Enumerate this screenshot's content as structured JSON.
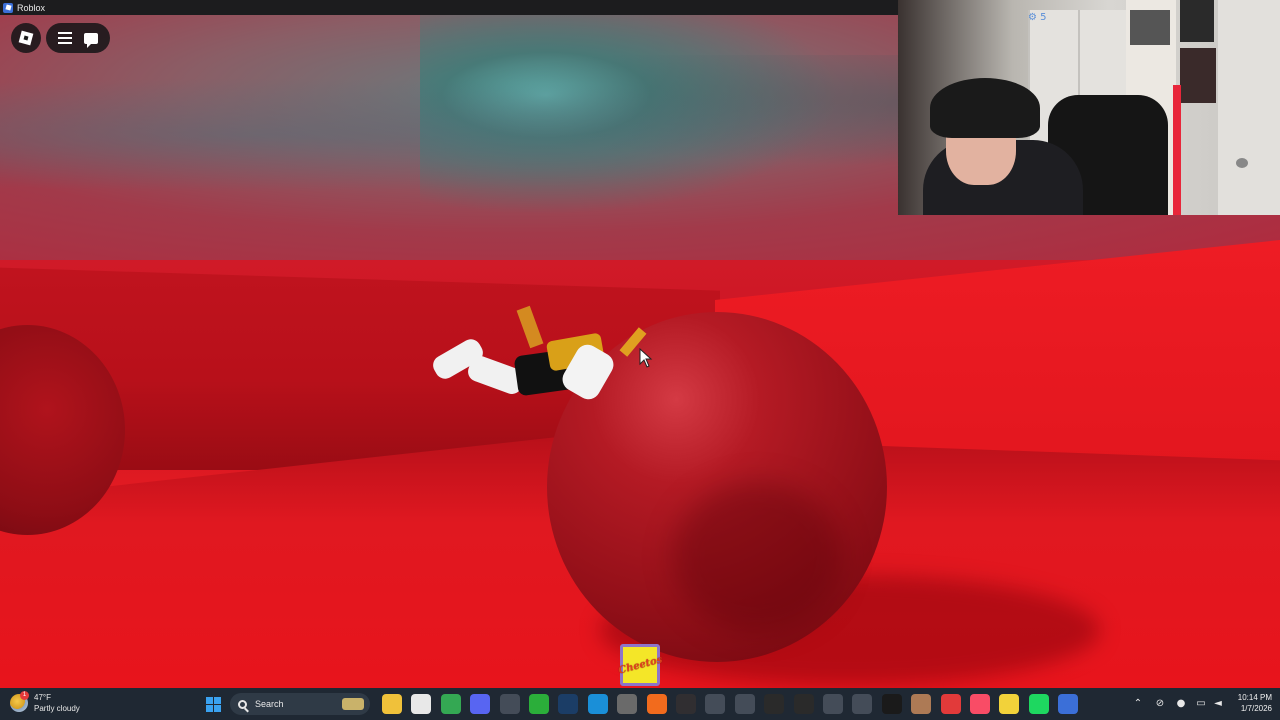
{
  "window": {
    "title": "Roblox"
  },
  "game": {
    "hotbar_item_label": "Cheetos"
  },
  "webcam": {
    "overlay_text": "⚙ 5"
  },
  "taskbar": {
    "weather": {
      "temperature": "47°F",
      "condition": "Partly cloudy",
      "badge": "1"
    },
    "search_placeholder": "Search",
    "clock": {
      "time": "10:14 PM",
      "date": "1/7/2026"
    },
    "pinned_apps": [
      {
        "name": "start-menu",
        "color": "#3aa2f0"
      },
      {
        "name": "file-explorer",
        "color": "#f0c13a"
      },
      {
        "name": "microsoft-store",
        "color": "#e8e8e8"
      },
      {
        "name": "chrome",
        "color": "#34a853"
      },
      {
        "name": "discord",
        "color": "#5865f2"
      },
      {
        "name": "task-manager",
        "color": "#444c58"
      },
      {
        "name": "xbox",
        "color": "#2bae3a"
      },
      {
        "name": "steam",
        "color": "#1b3d66"
      },
      {
        "name": "edge",
        "color": "#1a8fd8"
      },
      {
        "name": "minecraft",
        "color": "#6a6a6a"
      },
      {
        "name": "brave",
        "color": "#f26b1d"
      },
      {
        "name": "obs",
        "color": "#302e31"
      },
      {
        "name": "settings",
        "color": "#444c58"
      },
      {
        "name": "ea-app",
        "color": "#444c58"
      },
      {
        "name": "epic-games",
        "color": "#2a2a2a"
      },
      {
        "name": "capcut",
        "color": "#2a2a2a"
      },
      {
        "name": "media-4k",
        "color": "#444c58"
      },
      {
        "name": "chart-app",
        "color": "#444c58"
      },
      {
        "name": "cursor-app",
        "color": "#1a1a1a"
      },
      {
        "name": "voice-app",
        "color": "#ad7a55"
      },
      {
        "name": "youtube-studio",
        "color": "#e23a3a"
      },
      {
        "name": "apple-music",
        "color": "#f94c66"
      },
      {
        "name": "emoji-app",
        "color": "#f2d23a"
      },
      {
        "name": "spotify",
        "color": "#1ed760"
      },
      {
        "name": "roblox",
        "color": "#3b6fd8"
      }
    ],
    "tray_icons": [
      "chevron-up-icon",
      "network-off-icon",
      "mic-icon",
      "display-icon",
      "speaker-icon"
    ]
  }
}
